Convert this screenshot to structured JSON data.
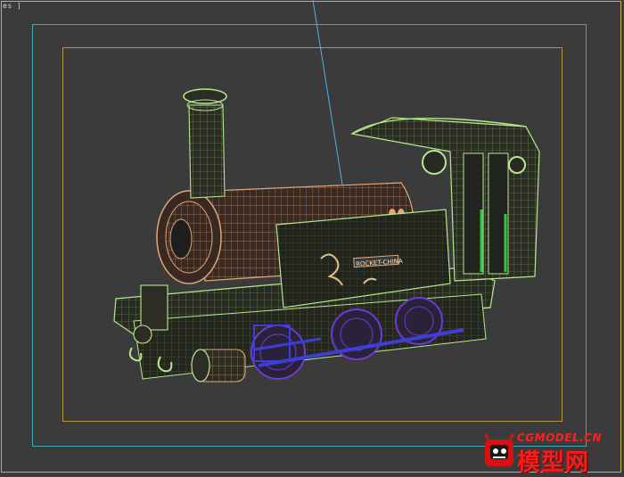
{
  "viewport": {
    "label": "es ]",
    "background": "#3b3b3b",
    "border_color": "#c9b24a",
    "safe_frame_outer_color": "#3fa9b8",
    "safe_frame_inner_color": "#b8963a"
  },
  "model": {
    "side_text": "ROCKET-CHINA",
    "wire_colors": {
      "body": "#b5e98e",
      "boiler": "#e0a878",
      "wheels": "#6b3bd6",
      "rods": "#3d3dd8",
      "accent": "#2fc93a"
    },
    "camera_line_color": "#4fb4e0"
  },
  "watermark": {
    "top_text": "CGMODEL.CN",
    "main_text": "模型网",
    "icon": "red-monster-mascot-icon",
    "color": "#ff1a1a"
  }
}
